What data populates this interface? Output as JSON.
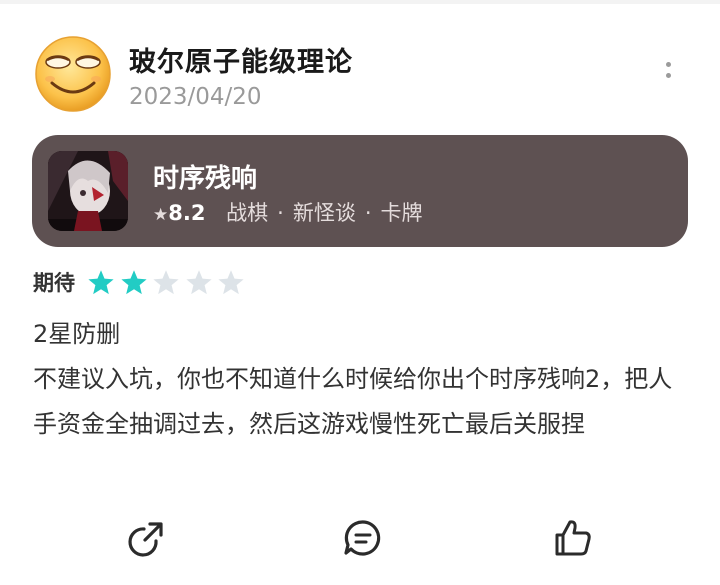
{
  "post": {
    "username": "玻尔原子能级理论",
    "date": "2023/04/20"
  },
  "game": {
    "title": "时序残响",
    "score": "8.2",
    "tags": [
      "战棋",
      "新怪谈",
      "卡牌"
    ]
  },
  "rating": {
    "label": "期待",
    "stars": 2,
    "max": 5,
    "filled_color": "#22ccc4",
    "empty_color": "#dde3e8"
  },
  "review": {
    "line1": "2星防删",
    "body": "不建议入坑，你也不知道什么时候给你出个时序残响2，把人手资金全抽调过去，然后这游戏慢性死亡最后关服捏"
  },
  "icons": {
    "more": "more-vertical-icon",
    "share": "share-icon",
    "comment": "comment-icon",
    "like": "thumbs-up-icon"
  }
}
